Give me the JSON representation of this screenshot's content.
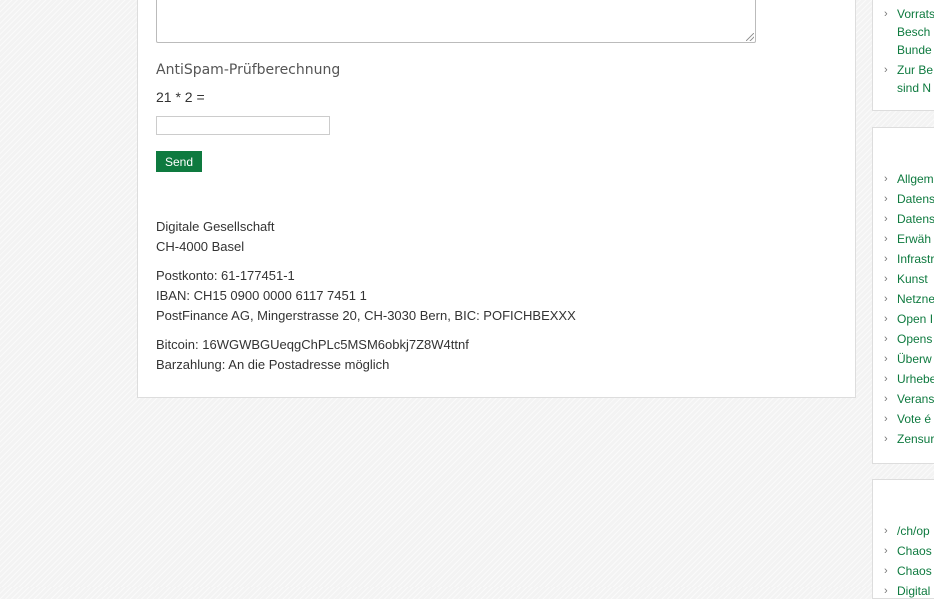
{
  "form": {
    "antispam_title": "AntiSpam-Prüfberechnung",
    "antispam_question": "21 * 2 =",
    "antispam_value": "",
    "send_label": "Send"
  },
  "info": {
    "org_name": "Digitale Gesellschaft",
    "org_city": "CH-4000 Basel",
    "postkonto": "Postkonto: 61-177451-1",
    "iban": "IBAN: CH15 0900 0000 6117 7451 1",
    "bank": "PostFinance AG, Mingerstrasse 20, CH-3030 Bern, BIC: POFICHBEXXX",
    "bitcoin": "Bitcoin: 16WGWBGUeqgChPLc5MSM6obkj7Z8W4ttnf",
    "cash": "Barzahlung: An die Postadresse möglich"
  },
  "sidebar": {
    "box1": [
      {
        "lines": [
          "Vorrats",
          "Besch",
          "Bunde"
        ]
      },
      {
        "lines": [
          "Zur Be",
          "sind N"
        ]
      }
    ],
    "box2": [
      "Allgem",
      "Datens",
      "Datens",
      "Erwäh",
      "Infrastr",
      "Kunst",
      "Netzne",
      "Open I",
      "Opens",
      "Überw",
      "Urhebe",
      "Verans",
      "Vote é",
      "Zensur"
    ],
    "box3": [
      "/ch/op",
      "Chaos",
      "Chaos",
      "Digital"
    ]
  },
  "colors": {
    "accent": "#0e7a3f",
    "link": "#0e7a3f"
  }
}
